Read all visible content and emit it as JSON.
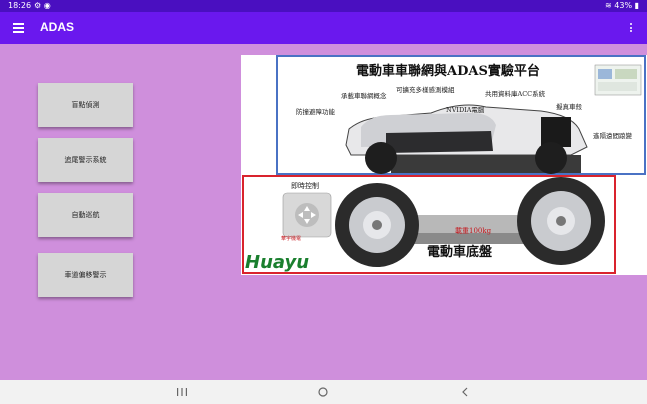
{
  "status_bar": {
    "time": "18:26",
    "battery": "43%"
  },
  "app_bar": {
    "title": "ADAS",
    "menu_icon": "hamburger-menu-icon",
    "more_icon": "more-vert-icon"
  },
  "buttons": [
    {
      "label": "盲點偵測"
    },
    {
      "label": "追尾警示系統"
    },
    {
      "label": "自動巡航"
    },
    {
      "label": "車道偏移警示"
    }
  ],
  "poster": {
    "title": "電動車車聯網與ADAS實驗平台",
    "labels": {
      "multi_sensor": "可擴充多樣感測模組",
      "iov": "承載車聯網概念",
      "shared_db": "共用資料庫ACC系統",
      "avoid": "防撞避障功能",
      "nvidia": "NVIDIA電腦",
      "sim_shell": "擬真車殼",
      "remote": "遙隔遠間踉變",
      "realtime": "即時控制",
      "load": "載重100kg",
      "chassis": "電動車底盤",
      "brand": "Huayu",
      "brand_cn": "華宇機電"
    },
    "colors": {
      "blue_frame": "#4a72c4",
      "red_frame": "#d9232d"
    }
  },
  "nav_bar": {
    "recent": "recent-apps-icon",
    "home": "home-icon",
    "back": "back-icon"
  }
}
